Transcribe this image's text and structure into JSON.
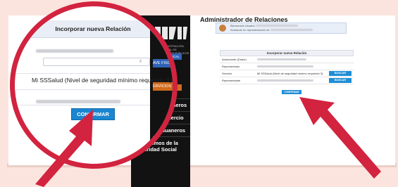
{
  "side": {
    "logo_text": "ADMINISTRACIÓN FEDERAL DE INGRESOS PÚBLICOS",
    "btn_blue": "CLAVE FISCAL",
    "btn_orange": "SERVICIOS",
    "menu": [
      "Aduaneros",
      "Comercio",
      "Usuarios Aduaneros",
      "Organismos de la Seguridad Social"
    ]
  },
  "main": {
    "title": "Administrador de Relaciones",
    "welcome_line1": "Bienvenido Usuario",
    "welcome_line2": "Actuando en representación de",
    "form_title": "Incorporar nueva Relación",
    "rows": [
      {
        "label": "Autorizante (Dador)",
        "value": ""
      },
      {
        "label": "Representado",
        "value": ""
      },
      {
        "label": "Servicio",
        "value": "Mi SSSalud (Nivel de seguridad mínimo requerido 3)",
        "button": "BUSCAR"
      },
      {
        "label": "Representante",
        "value": "",
        "button": "BUSCAR"
      }
    ],
    "confirm": "CONFIRMAR"
  },
  "zoom": {
    "title": "Incorporar nueva Relación",
    "service": "Mi SSSalud (Nivel de seguridad mínimo requerido 3)",
    "confirm": "CONFIRMAR",
    "side_fragments": [
      "AVE FISCAL",
      "ERVICIOS",
      "s",
      "Comercio",
      "Aduaneros"
    ]
  },
  "colors": {
    "arrow": "#d2233f",
    "button": "#1a86d1",
    "background": "#fbe4dd"
  }
}
